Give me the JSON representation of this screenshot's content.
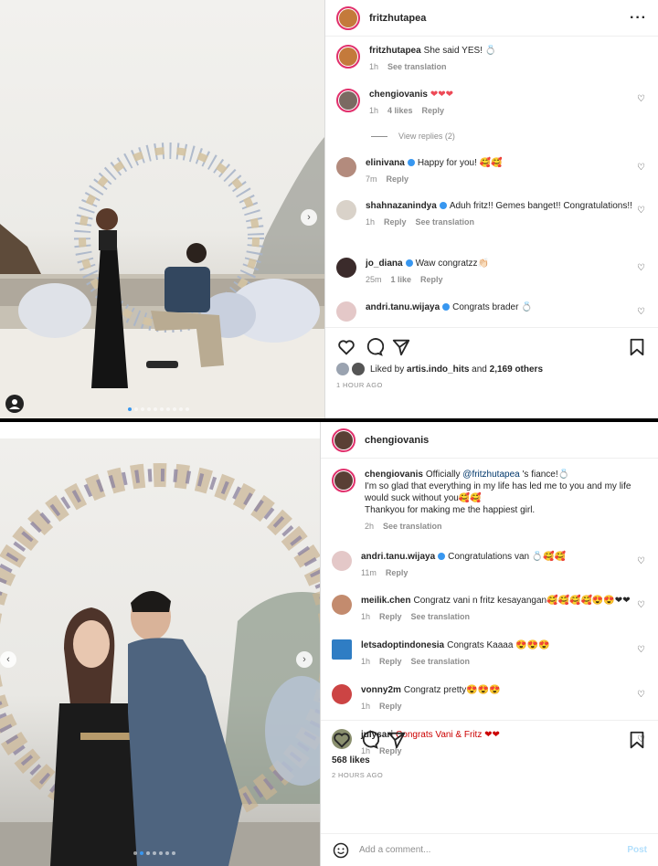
{
  "post1": {
    "username": "fritzhutapea",
    "comments": [
      {
        "user": "fritzhutapea",
        "text": "She said YES! 💍",
        "time": "1h",
        "actions": [
          "See translation"
        ],
        "likes": ""
      },
      {
        "user": "chengiovanis",
        "text": "❤❤❤",
        "time": "1h",
        "likes": "4 likes",
        "actions": [
          "Reply"
        ]
      },
      {
        "user": "elinivana",
        "text": "Happy for you! 🥰🥰",
        "time": "7m",
        "actions": [
          "Reply"
        ]
      },
      {
        "user": "shahnazanindya",
        "text": "Aduh fritz!! Gemes banget!! Congratulations!!",
        "time": "1h",
        "actions": [
          "Reply",
          "See translation"
        ]
      },
      {
        "user": "jo_diana",
        "text": "Waw congratzz👏🏻",
        "time": "25m",
        "likes": "1 like",
        "actions": [
          "Reply"
        ]
      },
      {
        "user": "andri.tanu.wijaya",
        "text": "Congrats brader 💍",
        "time": "",
        "actions": []
      }
    ],
    "view_replies": "View replies (2)",
    "liked_by_prefix": "Liked by",
    "liked_by_user": "artis.indo_hits",
    "liked_by_suffix": "and",
    "liked_by_count": "2,169 others",
    "timestamp": "1 HOUR AGO",
    "carousel": {
      "count": 10,
      "active": 0
    }
  },
  "post2": {
    "username": "chengiovanis",
    "caption": {
      "user": "chengiovanis",
      "pre": "Officially",
      "mention": "@fritzhutapea",
      "post": "'s fiance!💍",
      "line2": "I'm so glad that everything in my life has led me to you and my life would suck without you🥰🥰",
      "line3": "Thankyou for making me the happiest girl.",
      "time": "2h",
      "action": "See translation"
    },
    "comments": [
      {
        "user": "andri.tanu.wijaya",
        "text": "Congratulations van 💍🥰🥰",
        "time": "11m",
        "actions": [
          "Reply"
        ]
      },
      {
        "user": "meilik.chen",
        "text": "Congratz vani n fritz kesayangan🥰🥰🥰🥰😍😍❤❤",
        "time": "1h",
        "actions": [
          "Reply",
          "See translation"
        ]
      },
      {
        "user": "letsadoptindonesia",
        "text": "Congrats Kaaaa 😍😍😍",
        "time": "1h",
        "actions": [
          "Reply",
          "See translation"
        ]
      },
      {
        "user": "vonny2m",
        "text": "Congratz pretty😍😍😍",
        "time": "1h",
        "actions": [
          "Reply"
        ]
      },
      {
        "user": "julysari",
        "text": "Congrats Vani & Fritz ❤❤",
        "time": "1h",
        "actions": [
          "Reply"
        ]
      }
    ],
    "likes_count": "568 likes",
    "timestamp": "2 HOURS AGO",
    "add_comment_placeholder": "Add a comment...",
    "post_button": "Post",
    "carousel": {
      "count": 7,
      "active": 1
    }
  },
  "colors": {
    "verified": "#3897f0",
    "link": "#00376b",
    "muted": "#8e8e8e",
    "ring": "#e1306c"
  }
}
